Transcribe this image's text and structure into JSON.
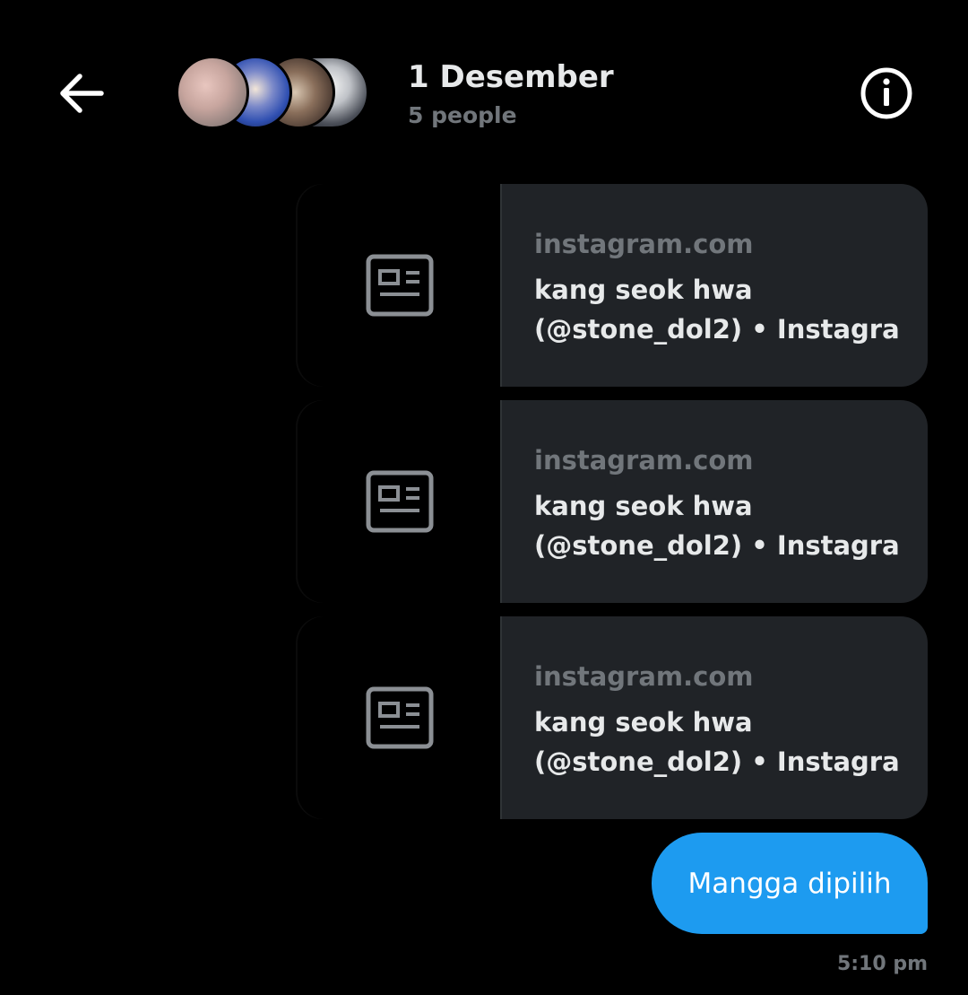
{
  "header": {
    "back_icon": "arrow-left-icon",
    "title": "1 Desember",
    "subtitle": "5 people",
    "info_icon": "info-circle-icon"
  },
  "messages": [
    {
      "type": "link-card",
      "icon": "news-article-icon",
      "domain": "instagram.com",
      "headline_line1": "kang seok hwa",
      "headline_line2": "(@stone_dol2) • Instagra..."
    },
    {
      "type": "link-card",
      "icon": "news-article-icon",
      "domain": "instagram.com",
      "headline_line1": "kang seok hwa",
      "headline_line2": "(@stone_dol2) • Instagra..."
    },
    {
      "type": "link-card",
      "icon": "news-article-icon",
      "domain": "instagram.com",
      "headline_line1": "kang seok hwa",
      "headline_line2": "(@stone_dol2) • Instagra..."
    },
    {
      "type": "text",
      "text": "Mangga dipilih"
    }
  ],
  "timestamp": "5:10 pm",
  "colors": {
    "background": "#000000",
    "card": "#202327",
    "bubble": "#1d9bf0",
    "muted_text": "#71767b",
    "primary_text": "#e7e9ea"
  }
}
